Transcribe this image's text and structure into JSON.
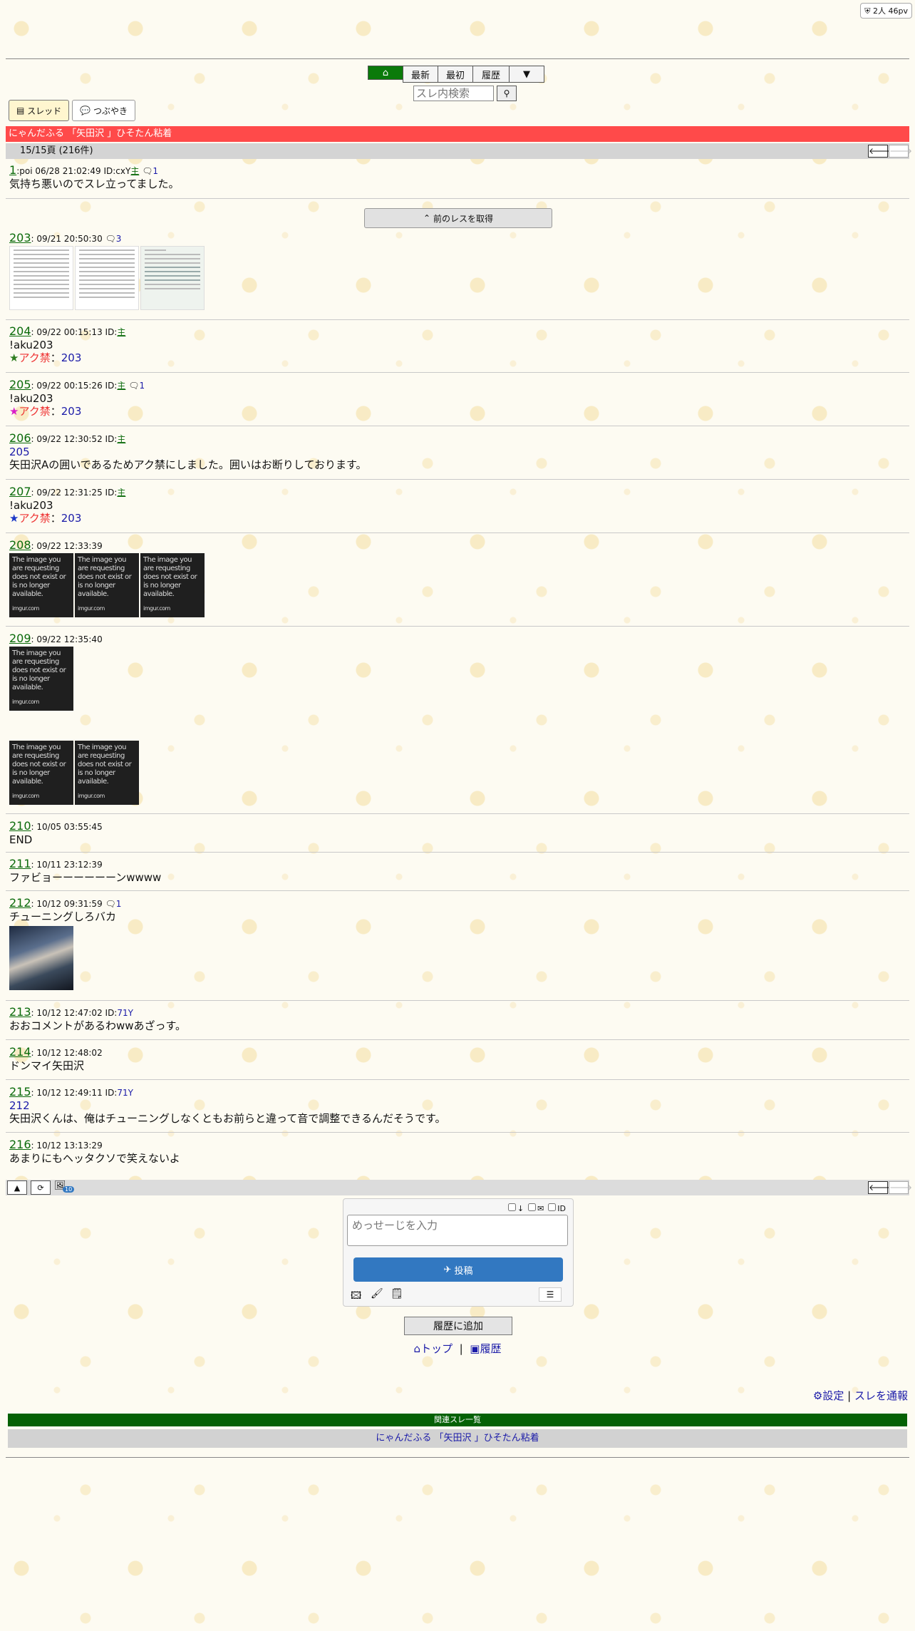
{
  "pv_badge": "2人 46pv",
  "nav": {
    "latest": "最新",
    "first": "最初",
    "history": "履歴",
    "more": "▼"
  },
  "search": {
    "placeholder": "スレ内検索"
  },
  "tabs": {
    "thread": "スレッド",
    "tweet": "つぶやき"
  },
  "thread_title": "にゃんだふる 「矢田沢 」ひそたん粘着",
  "page_info": "15/15頁 (216件)",
  "prev_res_button": "前のレスを取得",
  "posts": [
    {
      "num": "1",
      "prefix": ":poi",
      "date": "06/28 21:02:49",
      "id_label": "ID:cxY",
      "id_link": "主",
      "replies": "1",
      "lines": [
        "気持ち悪いのでスレ立ってました。"
      ]
    },
    {
      "num": "203",
      "date": "09/21 20:50:30",
      "replies": "3"
    },
    {
      "num": "204",
      "date": "09/22 00:15:13",
      "id_label": "ID:",
      "id_link": "主",
      "lines": [
        "!aku203"
      ],
      "ban_label": "アク禁",
      "ban_ref": "203",
      "star_color": "#2e7d1f"
    },
    {
      "num": "205",
      "date": "09/22 00:15:26",
      "id_label": "ID:",
      "id_link": "主",
      "replies": "1",
      "lines": [
        "!aku203"
      ],
      "ban_label": "アク禁",
      "ban_ref": "203",
      "star_color": "#d91ec8"
    },
    {
      "num": "206",
      "date": "09/22 12:30:52",
      "id_label": "ID:",
      "id_link": "主",
      "ref": "205",
      "lines": [
        "矢田沢Aの囲いであるためアク禁にしました。囲いはお断りしております。"
      ]
    },
    {
      "num": "207",
      "date": "09/22 12:31:25",
      "id_label": "ID:",
      "id_link": "主",
      "lines": [
        "!aku203"
      ],
      "ban_label": "アク禁",
      "ban_ref": "203",
      "star_color": "#1a37c7"
    },
    {
      "num": "208",
      "date": "09/22 12:33:39"
    },
    {
      "num": "209",
      "date": "09/22 12:35:40"
    },
    {
      "num": "210",
      "date": "10/05 03:55:45",
      "lines": [
        "END"
      ]
    },
    {
      "num": "211",
      "date": "10/11 23:12:39",
      "lines": [
        "ファビョーーーーーーンwwww"
      ]
    },
    {
      "num": "212",
      "date": "10/12 09:31:59",
      "replies": "1",
      "lines": [
        "チューニングしろバカ"
      ]
    },
    {
      "num": "213",
      "date": "10/12 12:47:02",
      "id_label": "ID:",
      "id_link": "71Y",
      "lines": [
        "おおコメントがあるわwwあざっす。"
      ]
    },
    {
      "num": "214",
      "date": "10/12 12:48:02",
      "lines": [
        "ドンマイ矢田沢"
      ]
    },
    {
      "num": "215",
      "date": "10/12 12:49:11",
      "id_label": "ID:",
      "id_link": "71Y",
      "ref": "212",
      "lines": [
        "矢田沢くんは、俺はチューニングしなくともお前らと違って音で調整できるんだそうです。"
      ]
    },
    {
      "num": "216",
      "date": "10/12 13:13:29",
      "lines": [
        "あまりにもヘッタクソで笑えないよ"
      ]
    }
  ],
  "missing_image_text": "The image you are requesting does not exist or is no longer available.",
  "missing_image_source": "imgur.com",
  "image_badge": "10",
  "form": {
    "check_sage": "↓",
    "check_mail": "✉",
    "check_id": "ID",
    "placeholder": "めっせーじを入力",
    "post_button": "投稿"
  },
  "history_add_button": "履歴に追加",
  "links": {
    "top": "トップ",
    "separator": "|",
    "history": "履歴"
  },
  "footer": {
    "settings": "設定",
    "separator": "|",
    "report": "スレを通報"
  },
  "related": {
    "header": "関連スレ一覧",
    "items": [
      "にゃんだふる 「矢田沢 」ひそたん粘着"
    ]
  },
  "colors": {
    "accent_green": "#0a7a0a",
    "title_red": "#ff4a4a",
    "post_button_blue": "#3278c1"
  }
}
